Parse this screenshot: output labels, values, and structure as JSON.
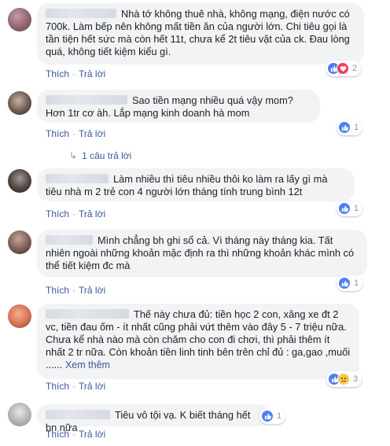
{
  "actions": {
    "like": "Thích",
    "reply": "Trả lời"
  },
  "comments": [
    {
      "text": "Nhà tớ không thuê nhà, không mạng, điện nước có 700k. Làm bếp nên không mất tiền ăn của người lớn. Chi tiêu gọi là tần tiện hết sức mà còn hết 11t, chưa kể 2t tiêu vặt của ck. Đau lòng quá, không tiết kiệm kiểu gì.",
      "reaction_count": "2",
      "reactions": [
        "like",
        "love"
      ]
    },
    {
      "text": "Sao tiền mạng nhiều quá vậy mom? Hơn 1tr cơ àh. Lắp mạng kinh doanh hà mom",
      "reaction_count": "1",
      "reactions": [
        "like"
      ],
      "replies_link": "1 câu trả lời"
    },
    {
      "text": "Làm nhiều thì tiêu nhiều thôi ko làm ra lấy gì mà tiêu nhà m 2 trẻ con 4 người lớn tháng tính trung bình 12t",
      "reaction_count": "1",
      "reactions": [
        "like"
      ]
    },
    {
      "text": "Mình chẳng bh ghi sổ cả. Vì tháng này tháng kia. Tất nhiên ngoài những khoản mặc định ra thì những khoản khác mình có thể tiết kiệm đc mà",
      "reaction_count": "1",
      "reactions": [
        "like"
      ]
    },
    {
      "text": "Thế này chưa đủ: tiền học 2 con, xăng xe đt 2 vc, tiền đau ốm - ít nhất cũng phải vứt thêm vào đây 5 - 7 triệu nữa. Chưa kể nhà nào mà còn chăm cho con đi chơi, thì phải thêm ít nhất 2 tr nữa. Còn khoản tiền linh tinh bên trên chỉ đủ : ga,gao ,muối ......",
      "see_more": "Xem thêm",
      "reaction_count": "3",
      "reactions": [
        "like",
        "sad"
      ]
    },
    {
      "text": "Tiêu vô tội vạ. K biết tháng hết bn nữa",
      "reaction_count": "1",
      "reactions": [
        "like"
      ]
    }
  ],
  "colors": {
    "link": "#385898",
    "bubble": "#f2f3f5",
    "like": "#4e7ff5",
    "love": "#f33e58",
    "sad": "#f7c84a"
  }
}
